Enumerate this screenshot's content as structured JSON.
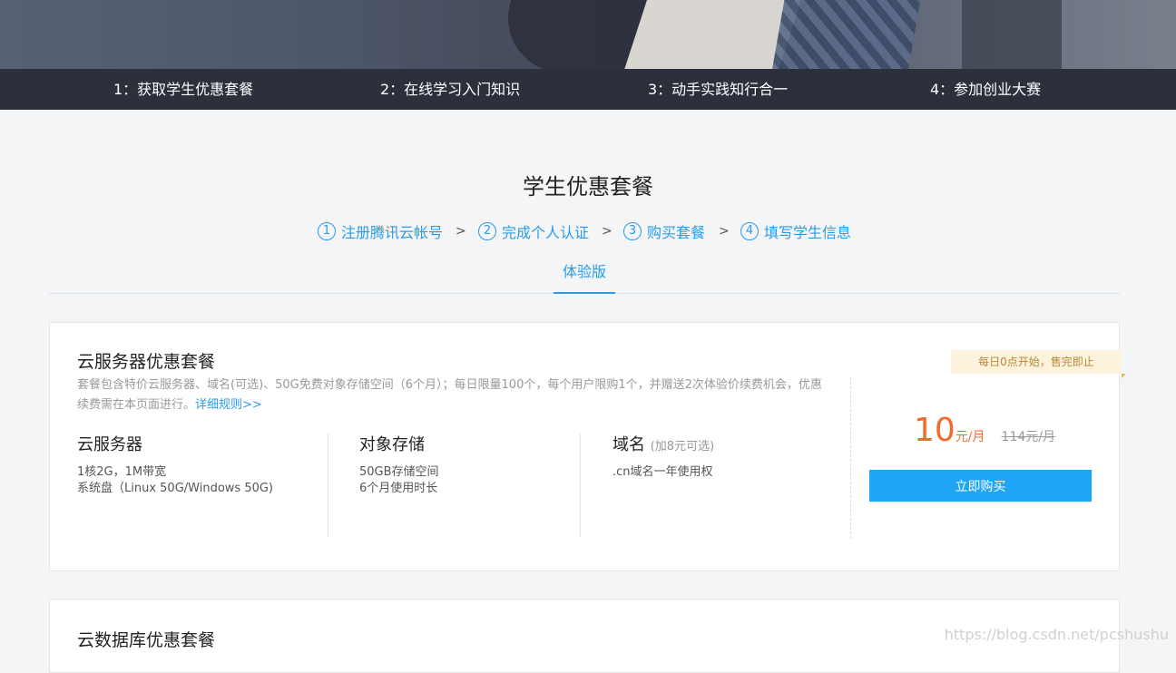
{
  "top_steps": [
    "1：获取学生优惠套餐",
    "2：在线学习入门知识",
    "3：动手实践知行合一",
    "4：参加创业大赛"
  ],
  "section": {
    "title": "学生优惠套餐",
    "steps": [
      {
        "num": "1",
        "label": "注册腾讯云帐号"
      },
      {
        "num": "2",
        "label": "完成个人认证"
      },
      {
        "num": "3",
        "label": "购买套餐"
      },
      {
        "num": "4",
        "label": "填写学生信息"
      }
    ],
    "chevron": ">",
    "tab": "体验版"
  },
  "card": {
    "title": "云服务器优惠套餐",
    "desc": "套餐包含特价云服务器、域名(可选)、50G免费对象存储空间（6个月）；每日限量100个，每个用户限购1个，并赠送2次体验价续费机会，优惠续费需在本页面进行。",
    "rules_link": "详细规则>>",
    "columns": [
      {
        "heading": "云服务器",
        "note": "",
        "lines": [
          "1核2G，1M带宽",
          "系统盘（Linux 50G/Windows 50G)"
        ]
      },
      {
        "heading": "对象存储",
        "note": "",
        "lines": [
          "50GB存储空间",
          "6个月使用时长"
        ]
      },
      {
        "heading": "域名",
        "note": "(加8元可选)",
        "lines": [
          ".cn域名一年使用权"
        ]
      }
    ],
    "badge": "每日0点开始，售完即止",
    "price": {
      "value": "10",
      "unit": "元/月",
      "old": "114元/月"
    },
    "buy_label": "立即购买"
  },
  "card2": {
    "title": "云数据库优惠套餐"
  },
  "watermark": "https://blog.csdn.net/pcshushu"
}
